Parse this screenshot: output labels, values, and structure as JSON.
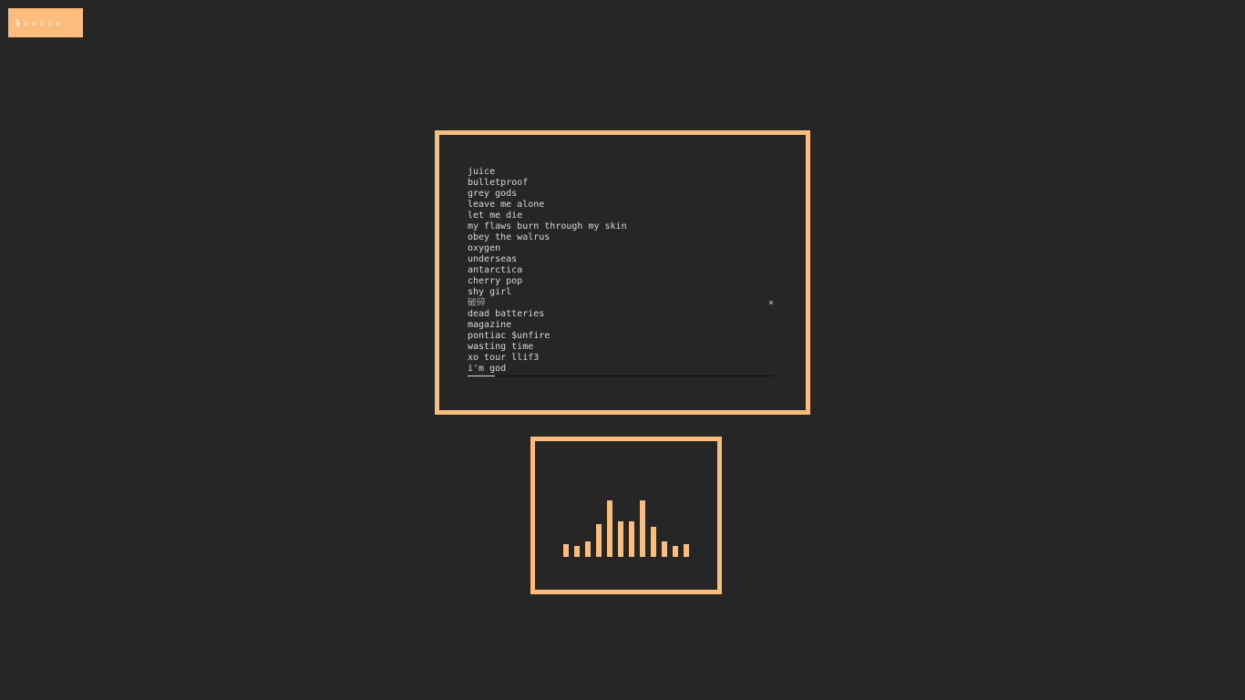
{
  "workspace_bar": {
    "label": "$",
    "dots": [
      "◇",
      "◇",
      "◇",
      "◇",
      "◇"
    ]
  },
  "playlist": {
    "tracks": [
      "juice",
      "bulletproof",
      "grey gods",
      "leave me alone",
      "let me die",
      "my flaws burn through my skin",
      "obey the walrus",
      "oxygen",
      "underseas",
      "antarctica",
      "cherry pop",
      "shy girl",
      "破碎",
      "dead batteries",
      "magazine",
      "pontiac $unfire",
      "wasting time",
      "xo tour llif3",
      "i'm god"
    ],
    "current_index": 12,
    "close_symbol": "×",
    "progress": 0.09
  },
  "visualizer": {
    "levels": [
      0.23,
      0.2,
      0.27,
      0.58,
      1.0,
      0.63,
      0.63,
      1.0,
      0.53,
      0.27,
      0.2,
      0.23
    ]
  },
  "colors": {
    "accent": "#fcbc7b",
    "background": "#262626",
    "text": "#d8d8d8"
  }
}
